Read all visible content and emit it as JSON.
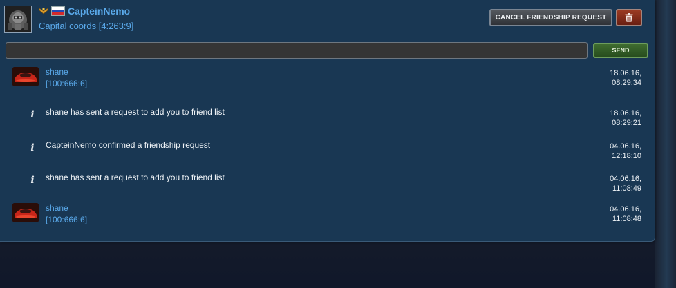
{
  "profile": {
    "username": "CapteinNemo",
    "coords": "Capital coords [4:263:9]",
    "rank_icon": "rank-insignia-icon",
    "flag_icon": "russia-flag-icon"
  },
  "actions": {
    "cancel_label": "CANCEL FRIENDSHIP REQUEST",
    "delete_icon": "trash-icon",
    "send_label": "SEND"
  },
  "message_input": {
    "value": "",
    "placeholder": ""
  },
  "messages": [
    {
      "type": "user",
      "name": "shane",
      "coords": "[100:666:6]",
      "date": "18.06.16,",
      "time": "08:29:34"
    },
    {
      "type": "system",
      "text": "shane has sent a request to add you to friend list",
      "date": "18.06.16,",
      "time": "08:29:21"
    },
    {
      "type": "system",
      "text": "CapteinNemo confirmed a friendship request",
      "date": "04.06.16,",
      "time": "12:18:10"
    },
    {
      "type": "system",
      "text": "shane has sent a request to add you to friend list",
      "date": "04.06.16,",
      "time": "11:08:49"
    },
    {
      "type": "user",
      "name": "shane",
      "coords": "[100:666:6]",
      "date": "04.06.16,",
      "time": "11:08:48"
    }
  ],
  "colors": {
    "panel": "#193753",
    "link": "#5aa9ea",
    "send_button": "#3f6c30",
    "delete_button": "#9a3a22"
  }
}
